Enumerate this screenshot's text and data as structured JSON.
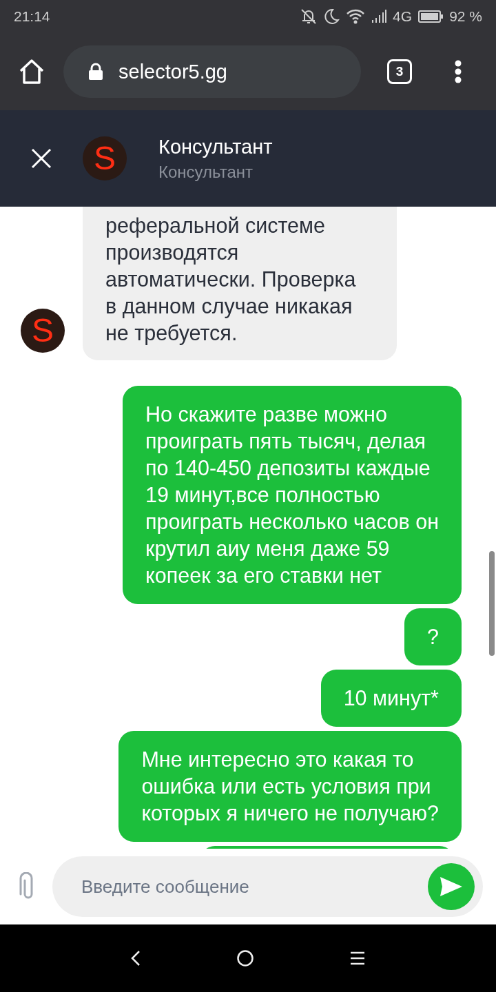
{
  "status_bar": {
    "time": "21:14",
    "network": "4G",
    "battery": "92 %"
  },
  "browser": {
    "url": "selector5.gg",
    "tab_count": "3"
  },
  "chat_header": {
    "avatar_letter": "S",
    "title": "Консультант",
    "subtitle": "Консультант"
  },
  "messages": [
    {
      "kind": "incoming",
      "avatar_letter": "S",
      "text": "реферальной системе\nпроизводятся\nавтоматически. Проверка\nв данном случае никакая\nне требуется."
    },
    {
      "kind": "outgoing",
      "text": "Но скажите разве можно\nпроиграть пять тысяч, делая\nпо 140-450 депозиты каждые\n19 минут,все полностью\nпроиграть несколько часов он\nкрутил аиу меня даже 59\nкопеек за его ставки нет"
    },
    {
      "kind": "outgoing",
      "text": "?"
    },
    {
      "kind": "outgoing",
      "text": "10 минут*"
    },
    {
      "kind": "outgoing",
      "text": "Мне интересно это какая то\nошибка или есть условия при\nкоторых я ничего не получаю?"
    }
  ],
  "composer": {
    "placeholder": "Введите сообщение"
  }
}
